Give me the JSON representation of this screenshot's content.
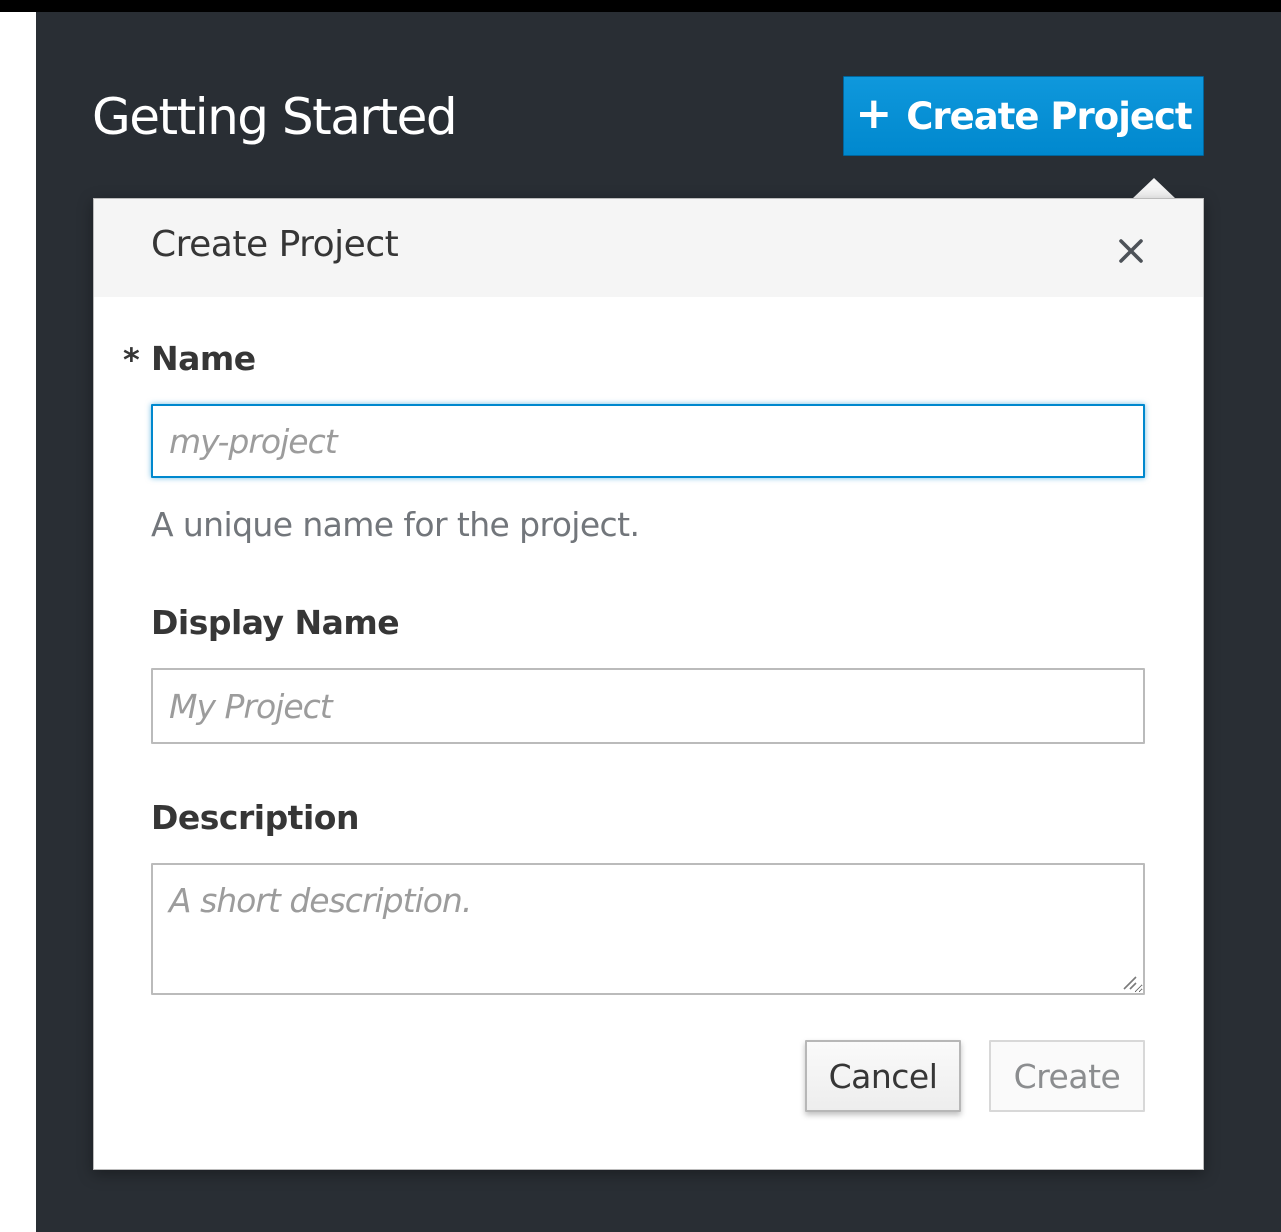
{
  "page": {
    "title": "Getting Started"
  },
  "toolbar": {
    "create_project_label": "Create Project",
    "create_project_icon": "plus-icon"
  },
  "popover": {
    "title": "Create Project",
    "close_icon": "close-icon",
    "fields": {
      "name": {
        "required_marker": "*",
        "label": "Name",
        "placeholder": "my-project",
        "value": "",
        "help": "A unique name for the project."
      },
      "display_name": {
        "label": "Display Name",
        "placeholder": "My Project",
        "value": ""
      },
      "description": {
        "label": "Description",
        "placeholder": "A short description.",
        "value": ""
      }
    },
    "actions": {
      "cancel_label": "Cancel",
      "create_label": "Create",
      "create_enabled": false
    }
  },
  "colors": {
    "background": "#292e34",
    "accent": "#0088ce",
    "header_bg": "#f5f5f5",
    "text": "#363636",
    "muted_text": "#72767b"
  }
}
